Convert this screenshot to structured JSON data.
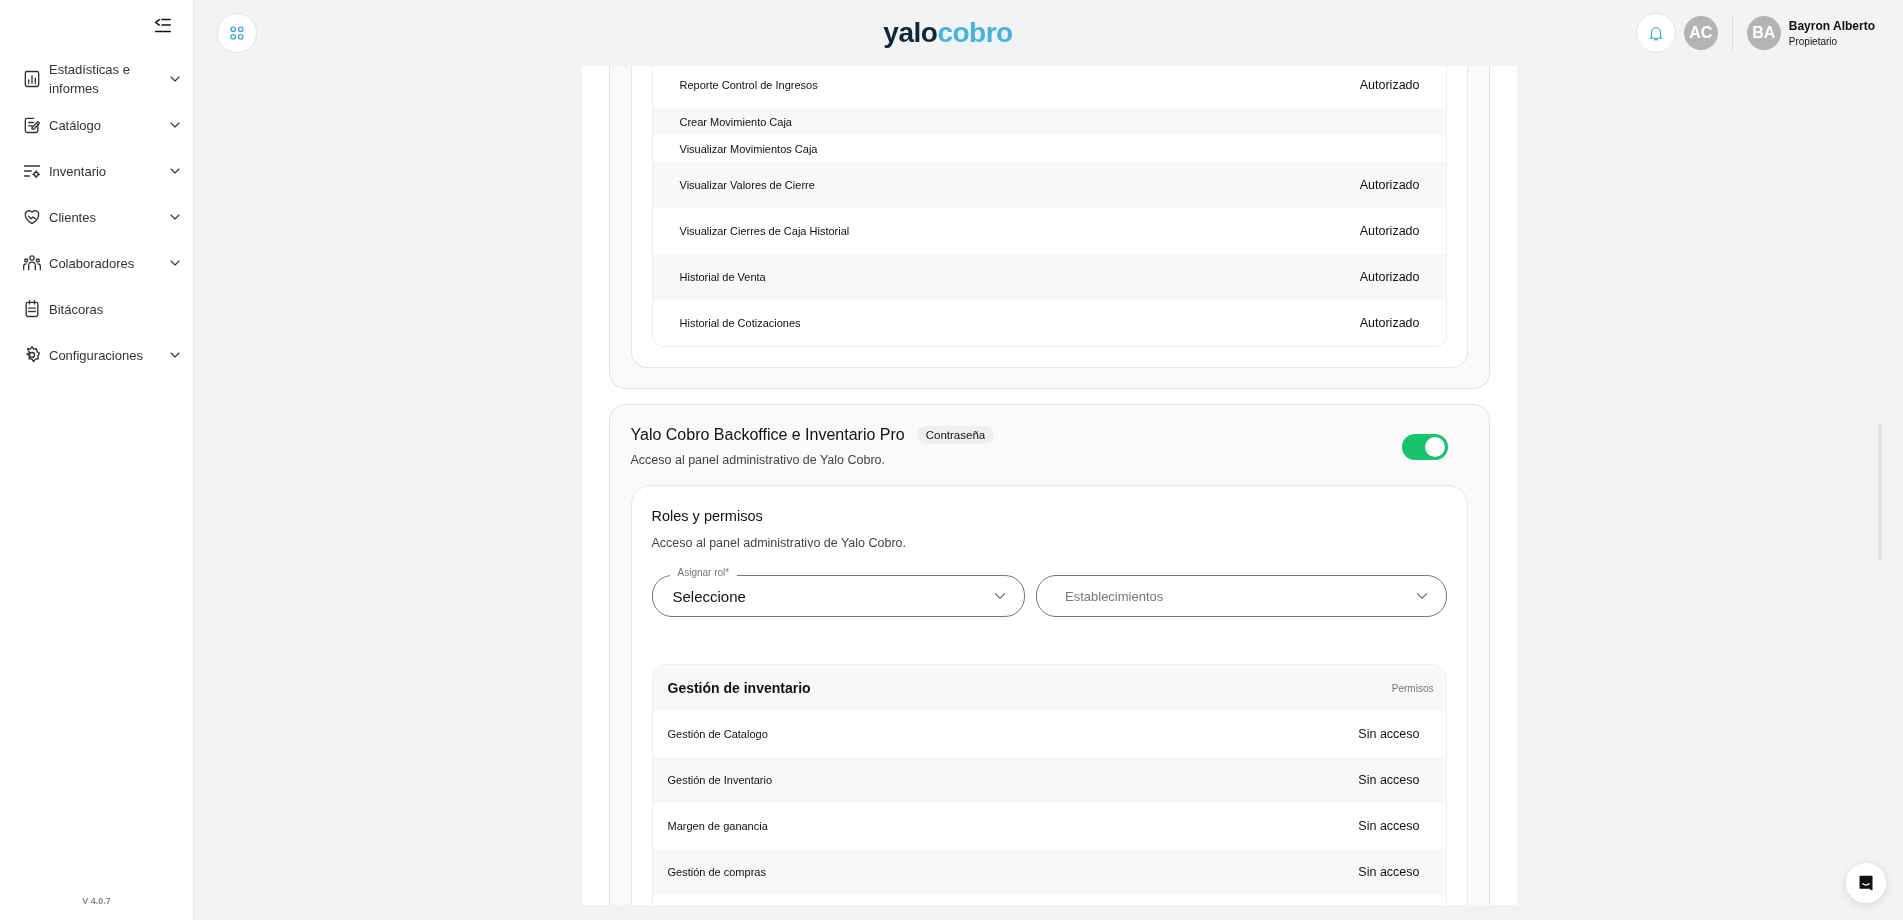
{
  "sidebar": {
    "items": [
      {
        "label": "Estadísticas e informes",
        "expandable": true
      },
      {
        "label": "Catálogo",
        "expandable": true
      },
      {
        "label": "Inventario",
        "expandable": true
      },
      {
        "label": "Clientes",
        "expandable": true
      },
      {
        "label": "Colaboradores",
        "expandable": true
      },
      {
        "label": "Bitácoras",
        "expandable": false
      },
      {
        "label": "Configuraciones",
        "expandable": true
      }
    ],
    "version": "V 4.0.7"
  },
  "header": {
    "logo": {
      "first": "yalo",
      "second": "cobro"
    },
    "avatar": "AC",
    "user": {
      "initials": "BA",
      "name": "Bayron Alberto",
      "role": "Propietario"
    }
  },
  "previous_card": {
    "permissions": [
      {
        "label": "Reporte Control de Ingresos",
        "value": "Autorizado"
      },
      {
        "label": "Crear Movimiento Caja"
      },
      {
        "label": "Visualizar Movimientos Caja"
      },
      {
        "label": "Visualizar Valores de Cierre",
        "value": "Autorizado"
      },
      {
        "label": "Visualizar Cierres de Caja Historial",
        "value": "Autorizado"
      },
      {
        "label": "Historial de Venta",
        "value": "Autorizado"
      },
      {
        "label": "Historial de Cotizaciones",
        "value": "Autorizado"
      }
    ]
  },
  "app_card": {
    "title": "Yalo Cobro Backoffice e Inventario Pro",
    "badge": "Contraseña",
    "description": "Acceso al panel administrativo de Yalo Cobro.",
    "enabled": true,
    "roles": {
      "title": "Roles y permisos",
      "description": "Acceso al panel administrativo de Yalo Cobro.",
      "role_field": {
        "label": "Asignar rol*",
        "value": "Seleccione"
      },
      "establishments_field": {
        "placeholder": "Establecimientos"
      },
      "table": {
        "title": "Gestión de inventario",
        "column": "Permisos",
        "rows": [
          {
            "label": "Gestión de Catalogo",
            "value": "Sin acceso"
          },
          {
            "label": "Gestión de Inventario",
            "value": "Sin acceso"
          },
          {
            "label": "Margen de ganancia",
            "value": "Sin acceso"
          },
          {
            "label": "Gestión de compras",
            "value": "Sin acceso"
          }
        ]
      }
    }
  }
}
